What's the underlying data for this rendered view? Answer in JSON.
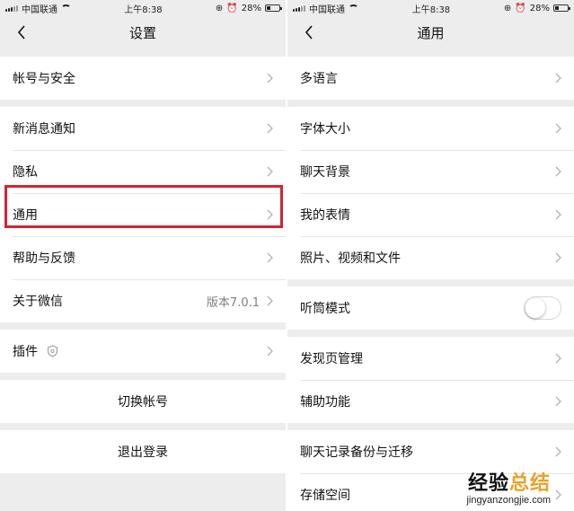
{
  "left": {
    "status": {
      "carrier": "中国联通",
      "time": "上午8:38",
      "battery": "28%"
    },
    "nav": {
      "title": "设置"
    },
    "groups": [
      [
        {
          "label": "帐号与安全"
        }
      ],
      [
        {
          "label": "新消息通知"
        },
        {
          "label": "隐私"
        },
        {
          "label": "通用"
        },
        {
          "label": "帮助与反馈"
        },
        {
          "label": "关于微信",
          "value": "版本7.0.1"
        }
      ],
      [
        {
          "label": "插件"
        }
      ],
      [
        {
          "label": "切换帐号"
        }
      ],
      [
        {
          "label": "退出登录"
        }
      ]
    ],
    "highlight_color": "#d42332"
  },
  "right": {
    "status": {
      "carrier": "中国联通",
      "time": "上午8:38",
      "battery": "28%"
    },
    "nav": {
      "title": "通用"
    },
    "groups": [
      [
        {
          "label": "多语言"
        }
      ],
      [
        {
          "label": "字体大小"
        },
        {
          "label": "聊天背景"
        },
        {
          "label": "我的表情"
        },
        {
          "label": "照片、视频和文件"
        }
      ],
      [
        {
          "label": "听筒模式",
          "toggle": false
        }
      ],
      [
        {
          "label": "发现页管理"
        },
        {
          "label": "辅助功能"
        }
      ],
      [
        {
          "label": "聊天记录备份与迁移"
        },
        {
          "label": "存储空间"
        }
      ]
    ]
  },
  "watermark": {
    "main_a": "经验",
    "main_b": "总结",
    "sub": "jingyanzongjie.com",
    "accent_color": "#e8a32a"
  }
}
